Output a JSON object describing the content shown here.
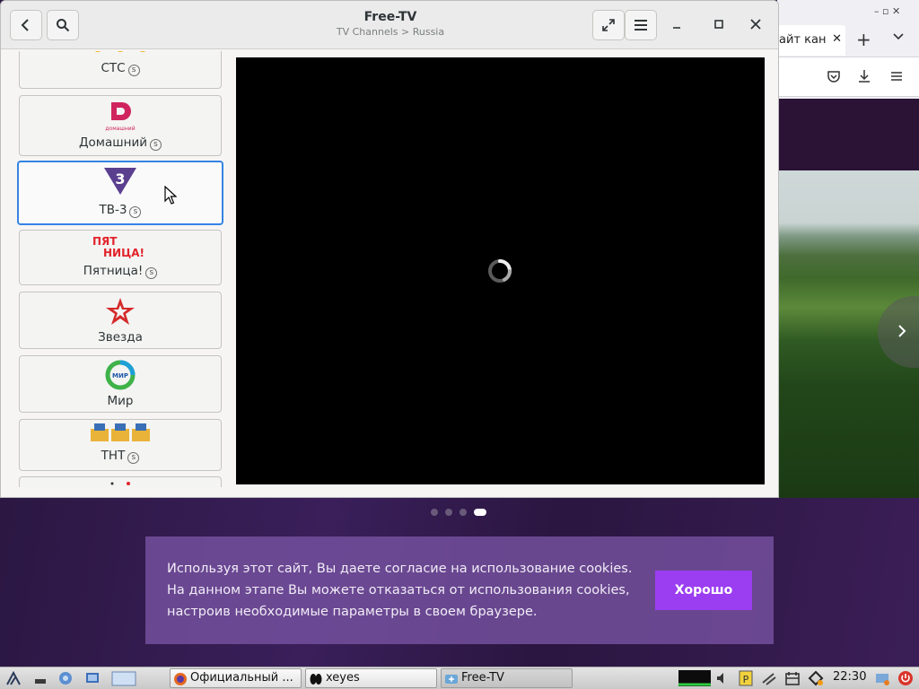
{
  "window": {
    "title": "Free-TV",
    "subtitle": "TV Channels > Russia"
  },
  "channels": [
    {
      "name": "СТС",
      "sub_icon": "s"
    },
    {
      "name": "Домашний",
      "sub_icon": "s",
      "logo_text": "домашний"
    },
    {
      "name": "ТВ-3",
      "sub_icon": "s",
      "logo_text": "3",
      "selected": true
    },
    {
      "name": "Пятница!",
      "sub_icon": "s",
      "logo_text_1": "ПЯТ",
      "logo_text_2": "НИЦА!"
    },
    {
      "name": "Звезда"
    },
    {
      "name": "Мир",
      "logo_text": "МИР"
    },
    {
      "name": "ТНТ",
      "sub_icon": "s"
    }
  ],
  "browser": {
    "tab_title": "айт кан",
    "controls": "– ▫ ✕"
  },
  "carousel": {
    "count": 4,
    "active": 3
  },
  "cookie": {
    "line1": "Используя этот сайт, Вы даете согласие на использование cookies.",
    "line2": "На данном этапе Вы можете отказаться от использования cookies,",
    "line3": "настроив необходимые параметры в своем браузере.",
    "button": "Хорошо"
  },
  "taskbar": {
    "tasks": [
      "Официальный ...",
      "xeyes",
      "Free-TV"
    ],
    "clock": "22:30"
  },
  "colors": {
    "accent": "#3584e4",
    "cookie_button": "#9b3df0",
    "page_bg": "#2a1640"
  }
}
